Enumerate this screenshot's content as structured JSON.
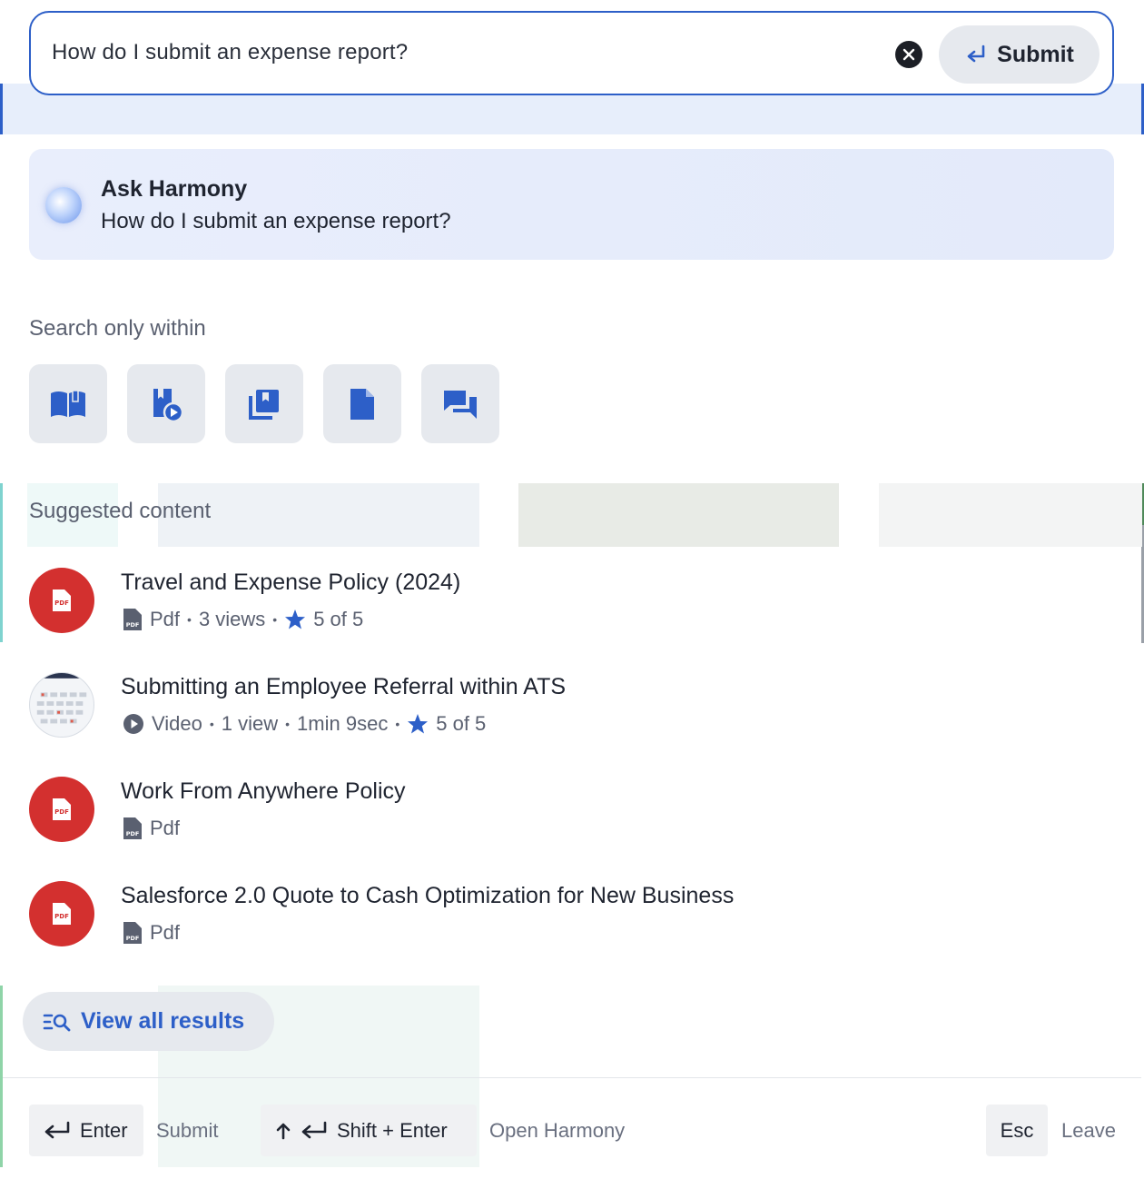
{
  "search": {
    "query": "How do I submit an expense report?",
    "submit_label": "Submit"
  },
  "ask": {
    "title": "Ask Harmony",
    "query": "How do I submit an expense report?"
  },
  "search_within": {
    "label": "Search only within",
    "filters": [
      "book-open-icon",
      "bookmark-video-icon",
      "library-icon",
      "document-icon",
      "chat-bubbles-icon"
    ]
  },
  "suggested": {
    "label": "Suggested content",
    "items": [
      {
        "title": "Travel and Expense Policy (2024)",
        "type": "Pdf",
        "views": "3 views",
        "rating": "5 of 5"
      },
      {
        "title": "Submitting an Employee Referral within ATS",
        "type": "Video",
        "views": "1 view",
        "duration": "1min 9sec",
        "rating": "5 of 5"
      },
      {
        "title": "Work From Anywhere Policy",
        "type": "Pdf"
      },
      {
        "title": "Salesforce 2.0 Quote to Cash Optimization for New Business",
        "type": "Pdf"
      }
    ]
  },
  "view_all": "View all results",
  "footer": {
    "enter_key": "Enter",
    "enter_hint": "Submit",
    "shift_key": "Shift + Enter",
    "shift_hint": "Open Harmony",
    "esc_key": "Esc",
    "esc_hint": "Leave"
  },
  "colors": {
    "accent": "#2d5fc8",
    "pdf_red": "#d3302f",
    "chip_bg": "#e6e9ee"
  }
}
